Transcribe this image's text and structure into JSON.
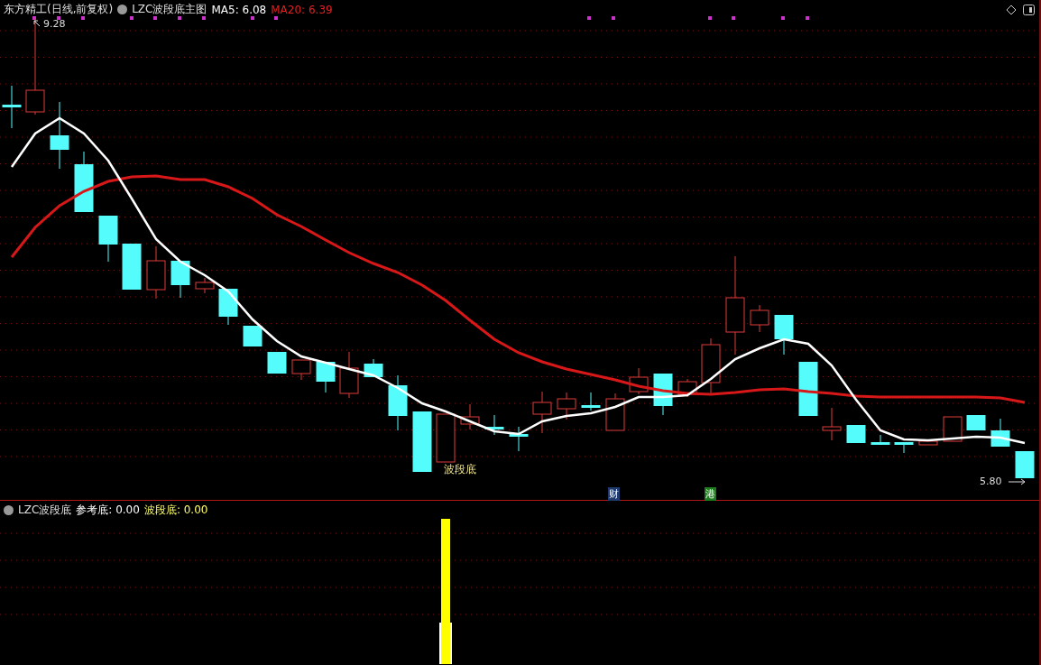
{
  "main_panel": {
    "stock_title": "东方精工(日线,前复权)",
    "indicator_name": "LZC波段底主图",
    "ma_readings": [
      {
        "label": "MA5: 6.08",
        "color": "#ffffff"
      },
      {
        "label": "MA20: 6.39",
        "color": "#e02020"
      }
    ],
    "high_label": "9.28",
    "low_label": "5.80",
    "signal_label": "波段底",
    "event_tags": [
      {
        "label": "财",
        "color": "#1e3a6e"
      },
      {
        "label": "港",
        "color": "#1d7a1d"
      }
    ]
  },
  "sub_panel": {
    "indicator_name": "LZC波段底",
    "readings": [
      {
        "label": "参考底: 0.00",
        "color": "#ffffff"
      },
      {
        "label": "波段底: 0.00",
        "color": "#ffff66"
      }
    ]
  }
}
